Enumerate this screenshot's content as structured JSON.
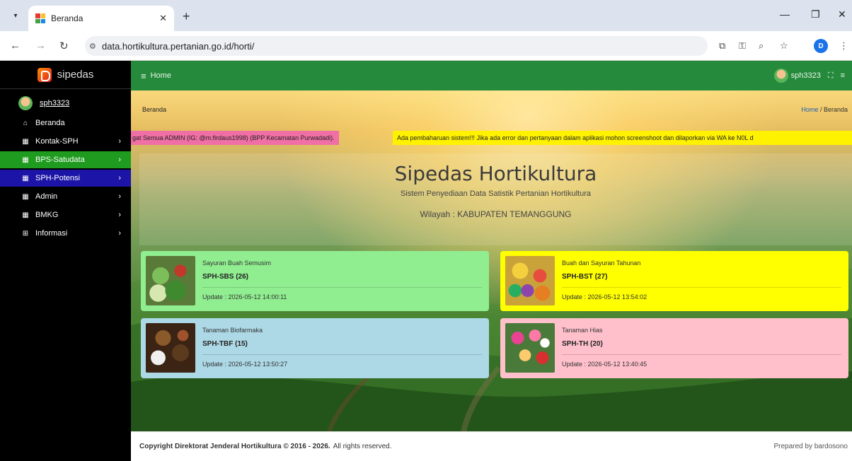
{
  "browser": {
    "tab_title": "Beranda",
    "url": "data.hortikultura.pertanian.go.id/horti/",
    "profile_initial": "D"
  },
  "sidebar": {
    "brand": "sipedas",
    "user": "sph3323",
    "items": [
      {
        "label": "Beranda",
        "icon": "home-icon"
      },
      {
        "label": "Kontak-SPH",
        "icon": "grid-icon"
      },
      {
        "label": "BPS-Satudata",
        "icon": "grid-icon"
      },
      {
        "label": "SPH-Potensi",
        "icon": "grid-icon"
      },
      {
        "label": "Admin",
        "icon": "grid-icon"
      },
      {
        "label": "BMKG",
        "icon": "grid-icon"
      },
      {
        "label": "Informasi",
        "icon": "book-icon"
      }
    ]
  },
  "topnav": {
    "home_label": "Home",
    "user": "sph3323"
  },
  "breadcrumb": {
    "left": "Beranda",
    "home": "Home",
    "separator": "/",
    "current": "Beranda"
  },
  "ticker": {
    "pink": "gat Semua ADMIN (IG: @m.firdaus1998) (BPP Kecamatan Purwadadi).",
    "yellow": "Ada pembaharuan sistem!!! Jika ada error dan pertanyaan dalam aplikasi mohon screenshoot dan dilaporkan via WA ke N0L d"
  },
  "hero": {
    "title": "Sipedas Hortikultura",
    "subtitle": "Sistem Penyediaan Data Satistik Pertanian Hortikultura",
    "region": "Wilayah : KABUPATEN TEMANGGUNG"
  },
  "cards": [
    {
      "category": "Sayuran Buah Semusim",
      "code": "SPH-SBS (26)",
      "update": "Update : 2026-05-12 14:00:11",
      "color": "#90ee90"
    },
    {
      "category": "Buah dan Sayuran Tahunan",
      "code": "SPH-BST (27)",
      "update": "Update : 2026-05-12 13:54:02",
      "color": "#ffff00"
    },
    {
      "category": "Tanaman Biofarmaka",
      "code": "SPH-TBF (15)",
      "update": "Update : 2026-05-12 13:50:27",
      "color": "#add8e6"
    },
    {
      "category": "Tanaman Hias",
      "code": "SPH-TH (20)",
      "update": "Update : 2026-05-12 13:40:45",
      "color": "#ffc0cb"
    }
  ],
  "footer": {
    "copyright": "Copyright Direktorat Jenderal Hortikultura © 2016 - 2026.",
    "rights": "All rights reserved.",
    "prepared": "Prepared by bardosono"
  }
}
